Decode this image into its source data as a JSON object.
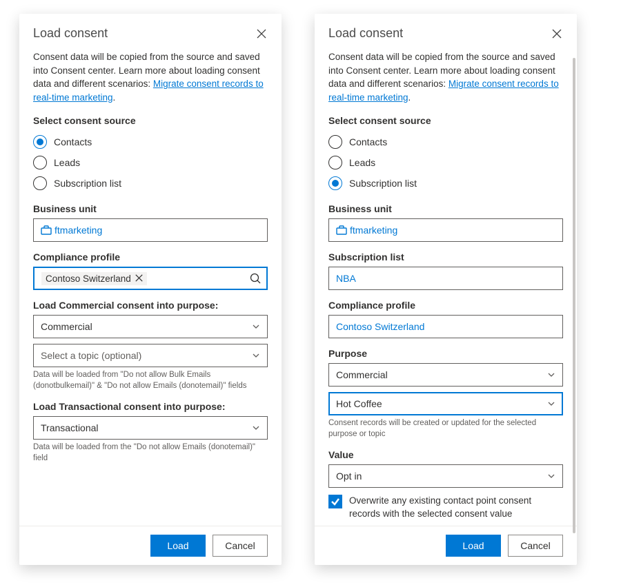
{
  "common": {
    "title": "Load consent",
    "intro_prefix": "Consent data will be copied from the source and saved into Consent center. Learn more about loading consent data and different scenarios: ",
    "intro_link": "Migrate consent records to real-time marketing",
    "source_label": "Select consent source",
    "source_options": [
      "Contacts",
      "Leads",
      "Subscription list"
    ],
    "business_unit_label": "Business unit",
    "business_unit_value": "ftmarketing",
    "compliance_label": "Compliance profile",
    "footer": {
      "load": "Load",
      "cancel": "Cancel"
    }
  },
  "panel_a": {
    "source_selected": 0,
    "compliance_value": "Contoso Switzerland",
    "commercial_heading": "Load Commercial consent into purpose:",
    "commercial_purpose": "Commercial",
    "commercial_topic_placeholder": "Select a topic (optional)",
    "commercial_help": "Data will be loaded from \"Do not allow Bulk Emails (donotbulkemail)\" & \"Do not allow Emails (donotemail)\" fields",
    "transactional_heading": "Load Transactional consent into purpose:",
    "transactional_purpose": "Transactional",
    "transactional_help": "Data will be loaded from the \"Do not allow Emails (donotemail)\" field"
  },
  "panel_b": {
    "source_selected": 2,
    "sublist_label": "Subscription list",
    "sublist_value": "NBA",
    "compliance_value": "Contoso Switzerland",
    "purpose_label": "Purpose",
    "purpose_value": "Commercial",
    "topic_value": "Hot Coffee",
    "purpose_help": "Consent records will be created or updated for the selected purpose or topic",
    "value_label": "Value",
    "value_value": "Opt in",
    "overwrite_label": "Overwrite any existing contact point consent records with the selected consent value",
    "overwrite_checked": true
  }
}
